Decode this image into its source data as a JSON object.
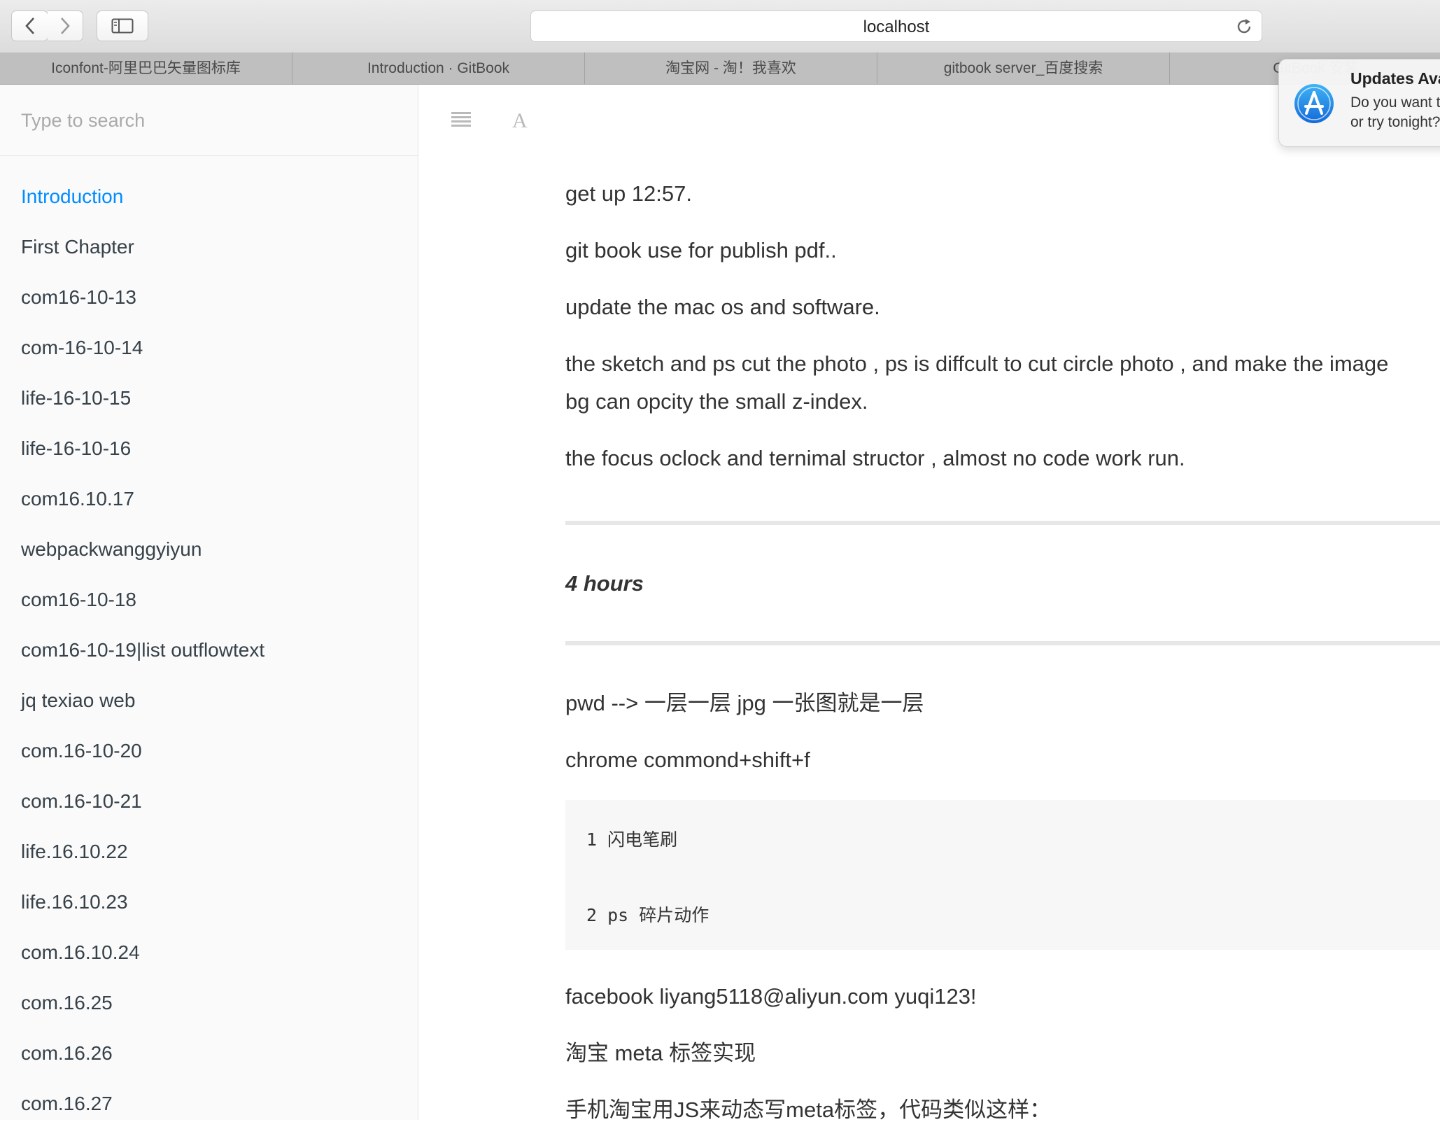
{
  "browser": {
    "url": "localhost",
    "tabs": [
      {
        "label": "Iconfont-阿里巴巴矢量图标库"
      },
      {
        "label": "Introduction · GitBook"
      },
      {
        "label": "淘宝网 - 淘！我喜欢"
      },
      {
        "label": "gitbook server_百度搜索"
      },
      {
        "label": "GitBook 安装"
      }
    ]
  },
  "icons": {
    "back": "chevron-left-icon",
    "forward": "chevron-right-icon",
    "sidebar_toggle": "sidebar-icon",
    "reload": "reload-icon",
    "toc": "list-icon",
    "font_settings": "font-icon",
    "app_store": "app-store-icon"
  },
  "colors": {
    "accent": "#008cff",
    "sidebar_bg": "#fafafa",
    "text": "#333333",
    "code_bg": "#f7f7f7"
  },
  "sidebar": {
    "search_placeholder": "Type to search",
    "items": [
      {
        "label": "Introduction",
        "active": true
      },
      {
        "label": "First Chapter"
      },
      {
        "label": "com16-10-13"
      },
      {
        "label": "com-16-10-14"
      },
      {
        "label": "life-16-10-15"
      },
      {
        "label": "life-16-10-16"
      },
      {
        "label": "com16.10.17"
      },
      {
        "label": "webpackwanggyiyun"
      },
      {
        "label": "com16-10-18"
      },
      {
        "label": "com16-10-19|list outflowtext"
      },
      {
        "label": "jq texiao web"
      },
      {
        "label": "com.16-10-20"
      },
      {
        "label": "com.16-10-21"
      },
      {
        "label": "life.16.10.22"
      },
      {
        "label": "life.16.10.23"
      },
      {
        "label": "com.16.10.24"
      },
      {
        "label": "com.16.25"
      },
      {
        "label": "com.16.26"
      },
      {
        "label": "com.16.27"
      }
    ]
  },
  "content": {
    "p1": "get up 12:57.",
    "p2": "git book use for publish pdf..",
    "p3": "update the mac os and software.",
    "p4_line1": "the sketch and ps cut the photo , ps is diffcult to cut circle photo , and make the image",
    "p4_line2": "bg can opcity the small z-index.",
    "p5": "the focus oclock and ternimal structor , almost no code work run.",
    "hours": "4 hours",
    "p6": "pwd --> 一层一层 jpg 一张图就是一层",
    "p7": "chrome commond+shift+f",
    "code_line1": "1 闪电笔刷",
    "code_line2": "2 ps 碎片动作",
    "p8": "facebook liyang5118@aliyun.com yuqi123!",
    "p9": "淘宝 meta 标签实现",
    "p10": "手机淘宝用JS来动态写meta标签，代码类似这样："
  },
  "notification": {
    "title": "Updates Available",
    "body_line1": "Do you want to install them now",
    "body_line2": "or try tonight?"
  }
}
